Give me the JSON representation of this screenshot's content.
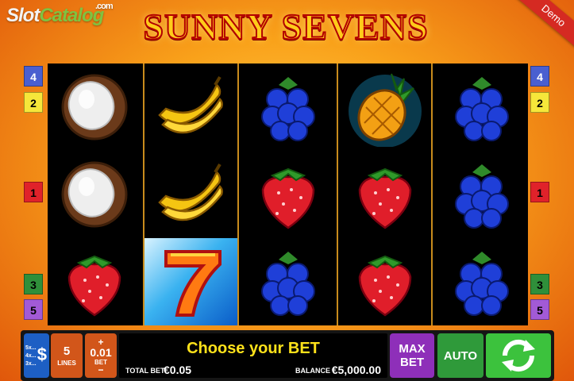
{
  "header": {
    "watermark_slot": "Slot",
    "watermark_catalog": "Catalog",
    "watermark_com": ".com",
    "title": "SUNNY SEVENS",
    "demo_ribbon": "Demo"
  },
  "reels": [
    [
      "coconut-icon",
      "coconut-icon",
      "strawberry-icon"
    ],
    [
      "banana-icon",
      "banana-icon",
      "seven-icon"
    ],
    [
      "blueberry-icon",
      "strawberry-icon",
      "blueberry-icon"
    ],
    [
      "pineapple-icon",
      "strawberry-icon",
      "strawberry-icon"
    ],
    [
      "blueberry-icon",
      "blueberry-icon",
      "blueberry-icon"
    ]
  ],
  "line_markers": {
    "left": [
      "4",
      "2",
      "1",
      "3",
      "5"
    ],
    "right": [
      "4",
      "2",
      "1",
      "3",
      "5"
    ]
  },
  "controls": {
    "paytable_rows": [
      "5x...",
      "4x...",
      "3x..."
    ],
    "paytable_symbol": "$",
    "lines_value": "5",
    "lines_label": "LINES",
    "bet_plus": "+",
    "bet_value": "0.01",
    "bet_label": "BET",
    "bet_minus": "−",
    "message": "Choose your BET",
    "total_bet_label": "TOTAL BET",
    "total_bet_value": "€0.05",
    "balance_label": "BALANCE",
    "balance_value": "€5,000.00",
    "max_bet_line1": "MAX",
    "max_bet_line2": "BET",
    "auto_label": "AUTO"
  },
  "colors": {
    "title": "#ffcc1a",
    "message": "#ffe21a",
    "max_bet": "#8e2fb9",
    "auto": "#2f9a3a",
    "spin": "#3cc23d",
    "lines_bet": "#d2561a"
  }
}
